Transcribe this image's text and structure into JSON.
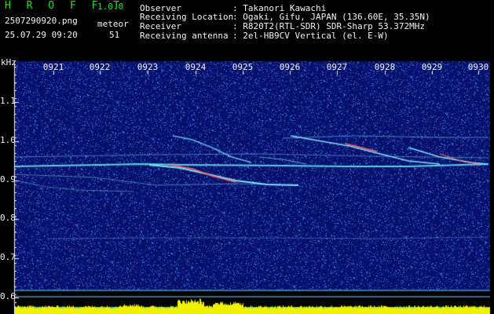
{
  "app": {
    "title": "H R O F F T",
    "version": "1.0.0"
  },
  "file_name": "2507290920.png",
  "date_time": "25.07.29 09:20",
  "meteor": {
    "label": "meteor",
    "count": "51"
  },
  "info": [
    {
      "label": "Observer",
      "value": ": Takanori Kawachi"
    },
    {
      "label": "Receiving Location",
      "value": ": Ogaki, Gifu, JAPAN (136.60E, 35.35N)"
    },
    {
      "label": "Receiver",
      "value": ": R820T2(RTL-SDR) SDR-Sharp 53.372MHz"
    },
    {
      "label": "Receiving antenna",
      "value": ": 2el-HB9CV Vertical (el. E-W)"
    }
  ],
  "spectrogram": {
    "y_unit": "kHz",
    "y_labels": [
      "1.1",
      "1.0",
      "0.9",
      "0.8",
      "0.7",
      "0.6"
    ],
    "time_labels": [
      "0921",
      "0922",
      "0923",
      "0924",
      "0925",
      "0926",
      "0927",
      "0928",
      "0929",
      "0930"
    ],
    "colors": {
      "background": "#08106a",
      "trace": "#7fe0ff",
      "hot": "#ff6464",
      "baseline": "#00d8ff",
      "amplitude": "#f0f000"
    }
  }
}
